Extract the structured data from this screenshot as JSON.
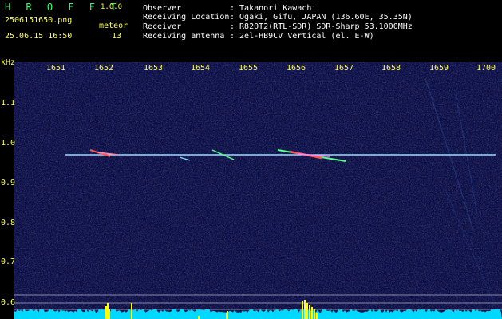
{
  "app": {
    "name": "H R O F F T",
    "version": "1.0.0",
    "filename": "2506151650.png",
    "datetime": "25.06.15 16:50",
    "counter_label": "meteor",
    "counter_value": "13"
  },
  "info": {
    "rows": [
      {
        "label": "Observer",
        "value": ": Takanori Kawachi"
      },
      {
        "label": "Receiving Location",
        "value": ": Ogaki, Gifu, JAPAN (136.60E, 35.35N)"
      },
      {
        "label": "Receiver",
        "value": ": R820T2(RTL-SDR) SDR-Sharp 53.1000MHz"
      },
      {
        "label": "Receiving antenna",
        "value": ": 2el-HB9CV Vertical (el. E-W)"
      }
    ]
  },
  "spectrogram": {
    "unit": "kHz",
    "x_ticks": [
      "1651",
      "1652",
      "1653",
      "1654",
      "1655",
      "1656",
      "1657",
      "1658",
      "1659",
      "1700"
    ],
    "y_ticks": [
      "1.1",
      "1.0",
      "0.9",
      "0.8",
      "0.7",
      "0.6"
    ],
    "colors": {
      "background": "#0a0a3a",
      "carrier": "#99ddff",
      "trace": "#55ff88",
      "peak": "#ff5555",
      "axis_text": "#ffff55",
      "bottom_spectrum": "#00e0ff",
      "bottom_peaks": "#ffff00"
    }
  }
}
